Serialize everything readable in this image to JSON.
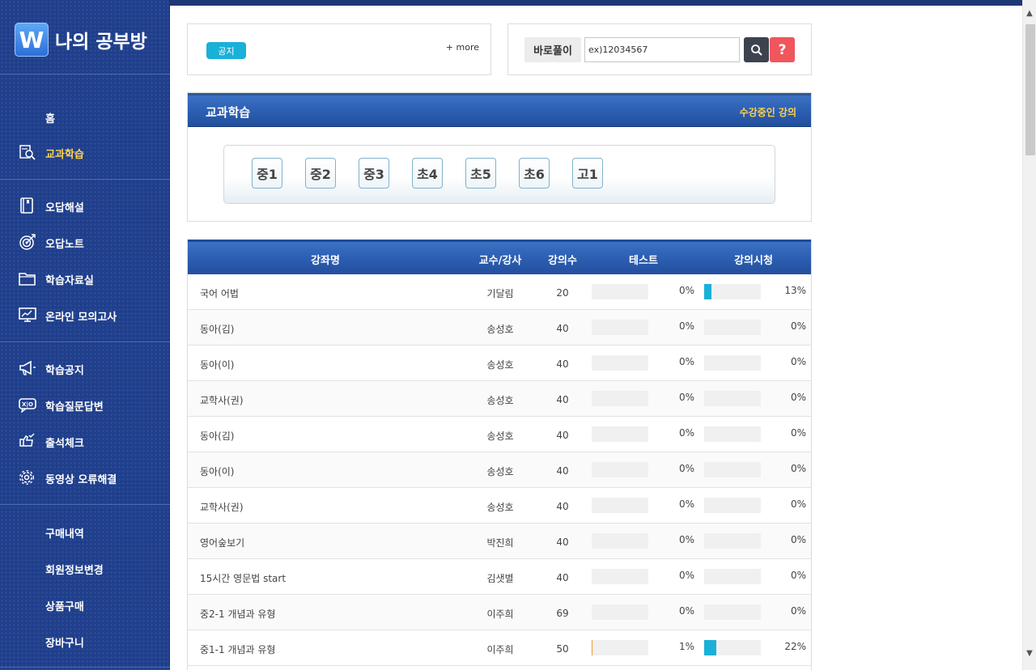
{
  "logo": {
    "badge": "W",
    "text": "나의 공부방"
  },
  "sidebar": {
    "items": [
      {
        "label": "홈",
        "icon": "none",
        "active": false
      },
      {
        "label": "교과학습",
        "icon": "search-doc-icon",
        "active": true
      },
      {
        "label": "오답해설",
        "icon": "book-icon",
        "active": false
      },
      {
        "label": "오답노트",
        "icon": "target-icon",
        "active": false
      },
      {
        "label": "학습자료실",
        "icon": "folder-icon",
        "active": false
      },
      {
        "label": "온라인 모의고사",
        "icon": "monitor-chart-icon",
        "active": false
      },
      {
        "label": "학습공지",
        "icon": "megaphone-icon",
        "active": false
      },
      {
        "label": "학습질문답변",
        "icon": "chat-qa-icon",
        "active": false
      },
      {
        "label": "출석체크",
        "icon": "hand-check-icon",
        "active": false
      },
      {
        "label": "동영상 오류해결",
        "icon": "gear-icon",
        "active": false
      },
      {
        "label": "구매내역",
        "icon": "none",
        "active": false
      },
      {
        "label": "회원정보변경",
        "icon": "none",
        "active": false
      },
      {
        "label": "상품구매",
        "icon": "none",
        "active": false
      },
      {
        "label": "장바구니",
        "icon": "none",
        "active": false
      }
    ]
  },
  "notice": {
    "badge": "공지",
    "more": "+ more"
  },
  "quick_solve": {
    "label": "바로풀이",
    "placeholder": "ex)12034567",
    "help": "?"
  },
  "subject": {
    "title": "교과학습",
    "link": "수강중인 강의",
    "grades": [
      "중1",
      "중2",
      "중3",
      "초4",
      "초5",
      "초6",
      "고1"
    ]
  },
  "table": {
    "headers": {
      "name": "강좌명",
      "teacher": "교수/강사",
      "count": "강의수",
      "test": "테스트",
      "watch": "강의시청"
    },
    "rows": [
      {
        "name": "국어 어법",
        "teacher": "기달림",
        "count": "20",
        "test_pct": 0,
        "test": "0%",
        "watch_pct": 13,
        "watch": "13%"
      },
      {
        "name": "동아(김)",
        "teacher": "송성호",
        "count": "40",
        "test_pct": 0,
        "test": "0%",
        "watch_pct": 0,
        "watch": "0%"
      },
      {
        "name": "동아(이)",
        "teacher": "송성호",
        "count": "40",
        "test_pct": 0,
        "test": "0%",
        "watch_pct": 0,
        "watch": "0%"
      },
      {
        "name": "교학사(권)",
        "teacher": "송성호",
        "count": "40",
        "test_pct": 0,
        "test": "0%",
        "watch_pct": 0,
        "watch": "0%"
      },
      {
        "name": "동아(김)",
        "teacher": "송성호",
        "count": "40",
        "test_pct": 0,
        "test": "0%",
        "watch_pct": 0,
        "watch": "0%"
      },
      {
        "name": "동아(이)",
        "teacher": "송성호",
        "count": "40",
        "test_pct": 0,
        "test": "0%",
        "watch_pct": 0,
        "watch": "0%"
      },
      {
        "name": "교학사(권)",
        "teacher": "송성호",
        "count": "40",
        "test_pct": 0,
        "test": "0%",
        "watch_pct": 0,
        "watch": "0%"
      },
      {
        "name": "영어숲보기",
        "teacher": "박진희",
        "count": "40",
        "test_pct": 0,
        "test": "0%",
        "watch_pct": 0,
        "watch": "0%"
      },
      {
        "name": "15시간 영문법 start",
        "teacher": "김샛별",
        "count": "40",
        "test_pct": 0,
        "test": "0%",
        "watch_pct": 0,
        "watch": "0%"
      },
      {
        "name": "중2-1 개념과 유형",
        "teacher": "이주희",
        "count": "69",
        "test_pct": 0,
        "test": "0%",
        "watch_pct": 0,
        "watch": "0%"
      },
      {
        "name": "중1-1 개념과 유형",
        "teacher": "이주희",
        "count": "50",
        "test_pct": 1,
        "test": "1%",
        "watch_pct": 22,
        "watch": "22%"
      }
    ]
  },
  "colors": {
    "sidebar_bg": "#1f3f8c",
    "header_blue": "#2b5db0",
    "accent_yellow": "#ffd34d",
    "badge_cyan": "#1ab0d8",
    "help_red": "#f0565c"
  }
}
